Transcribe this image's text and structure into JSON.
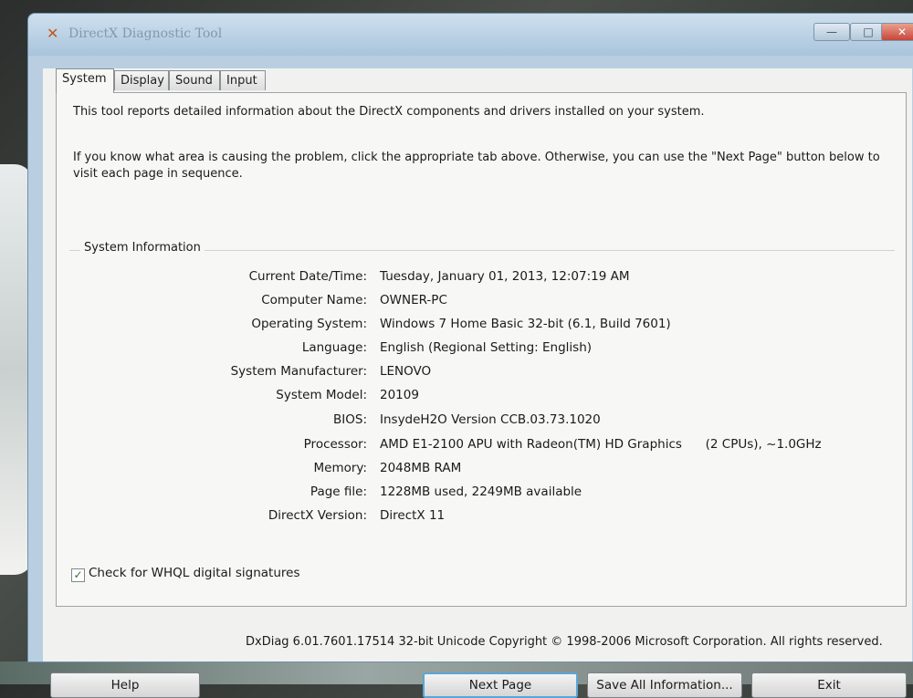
{
  "window": {
    "title": "DirectX Diagnostic Tool",
    "controls": {
      "minimize": "—",
      "maximize": "□",
      "close": "✕"
    }
  },
  "tabs": [
    {
      "label": "System",
      "active": true
    },
    {
      "label": "Display",
      "active": false
    },
    {
      "label": "Sound",
      "active": false
    },
    {
      "label": "Input",
      "active": false
    }
  ],
  "intro": {
    "line1": "This tool reports detailed information about the DirectX components and drivers installed on your system.",
    "line2": "If you know what area is causing the problem, click the appropriate tab above.  Otherwise, you can use the \"Next Page\" button below to",
    "line3": "visit each page in sequence."
  },
  "system_info": {
    "group_label": "System Information",
    "rows": [
      {
        "label": "Current Date/Time:",
        "value": "Tuesday, January 01, 2013, 12:07:19 AM"
      },
      {
        "label": "Computer Name:",
        "value": "OWNER-PC"
      },
      {
        "label": "Operating System:",
        "value": "Windows 7 Home Basic 32-bit (6.1, Build 7601)"
      },
      {
        "label": "Language:",
        "value": "English (Regional Setting: English)"
      },
      {
        "label": "System Manufacturer:",
        "value": "LENOVO"
      },
      {
        "label": "System Model:",
        "value": "20109"
      },
      {
        "label": "BIOS:",
        "value": "InsydeH2O Version CCB.03.73.1020"
      },
      {
        "label": "Processor:",
        "value": "AMD E1-2100 APU with Radeon(TM) HD Graphics      (2 CPUs), ~1.0GHz"
      },
      {
        "label": "Memory:",
        "value": "2048MB RAM"
      },
      {
        "label": "Page file:",
        "value": "1228MB used, 2249MB available"
      },
      {
        "label": "DirectX Version:",
        "value": "DirectX 11"
      }
    ]
  },
  "whql": {
    "label": "Check for WHQL digital signatures",
    "checked": true
  },
  "version_line": "DxDiag 6.01.7601.17514 32-bit Unicode  Copyright © 1998-2006 Microsoft Corporation.  All rights reserved.",
  "buttons": {
    "help": "Help",
    "next_page": "Next Page",
    "save_all": "Save All Information...",
    "exit": "Exit"
  }
}
